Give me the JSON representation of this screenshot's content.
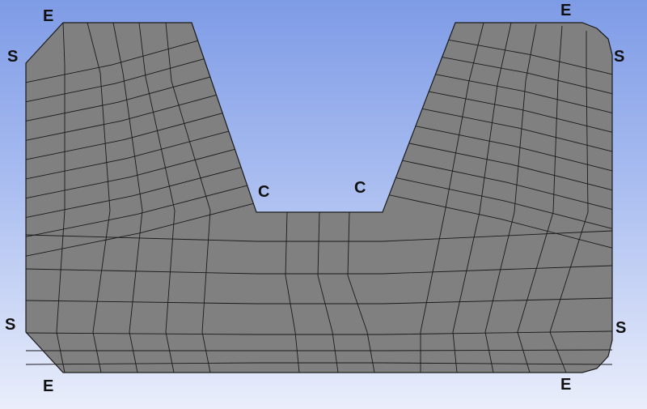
{
  "mesh": {
    "fill": "#808080",
    "line": "#1a1a1a",
    "background_top": "#7e9be6",
    "background_bottom": "#eaeefb"
  },
  "labels": {
    "top_left_e": "E",
    "top_left_s": "S",
    "top_right_e": "E",
    "top_right_s": "S",
    "notch_left_c": "C",
    "notch_right_c": "C",
    "bottom_left_s": "S",
    "bottom_left_e": "E",
    "bottom_right_s": "S",
    "bottom_right_e": "E"
  }
}
